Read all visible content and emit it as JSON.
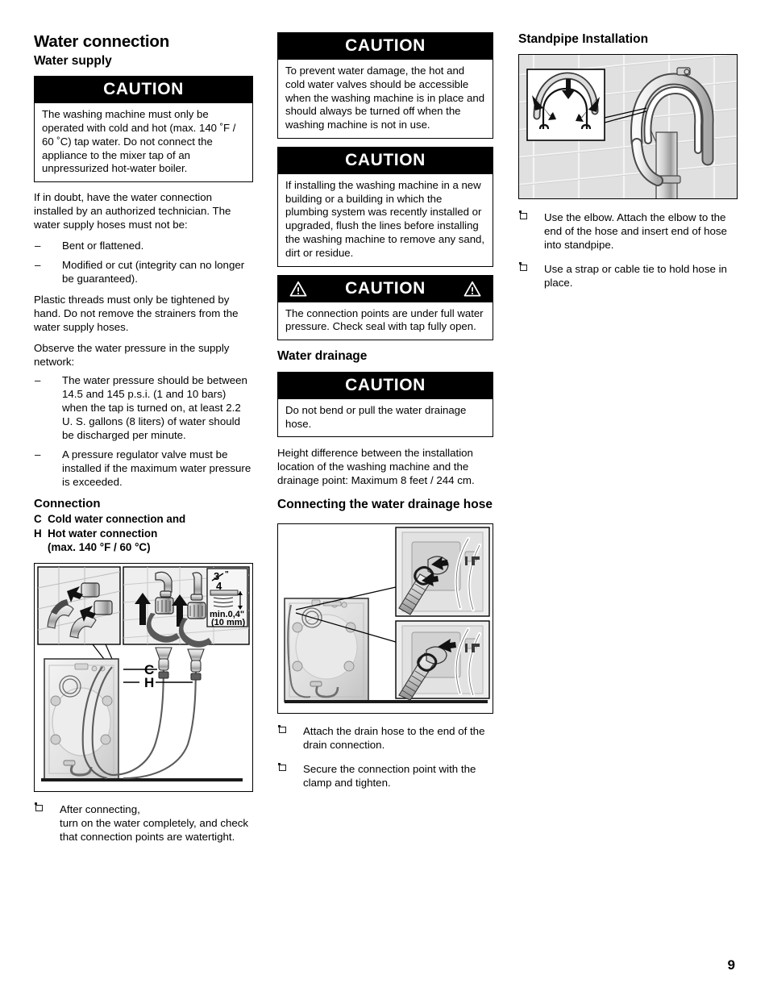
{
  "page": {
    "number": "9"
  },
  "left_column": {
    "title": "Water connection",
    "section": "Water supply",
    "caution1": {
      "label": "CAUTION",
      "text": "The washing machine must only be operated with cold and hot (max. 140 ˚F / 60 ˚C) tap water. Do not connect the appliance to the mixer tap of an unpressurized hot-water boiler."
    },
    "para1": "If in doubt, have the water connection installed by an authorized technician. The water supply hoses must not be:",
    "dash_items_1": [
      "Bent or flattened.",
      "Modified or cut (integrity can no longer be guaranteed)."
    ],
    "para2": "Plastic threads must only be tightened by hand. Do not remove the strainers from the water supply hoses.",
    "para3": "Observe the water pressure in the supply network:",
    "dash_items_2": [
      "The water pressure should be between 14.5 and 145 p.s.i. (1 and 10 bars) when the tap is turned on, at least 2.2 U. S. gallons (8 liters) of water should be discharged per minute.",
      "A pressure regulator valve must be installed if the maximum water pressure is exceeded."
    ],
    "connection_heading": "Connection",
    "connection_lines": [
      "C  Cold water connection and",
      "H  Hot water connection"
    ],
    "connection_sub": "(max. 140 °F / 60 °C)",
    "figure": {
      "name": "water-supply-hose-connection-diagram",
      "labels": {
        "cold": "C",
        "hot": "H",
        "thread_size": "3/4\"",
        "min_length": "min.0,4\"",
        "min_length_metric": "(10 mm)"
      }
    },
    "box_items": [
      "After connecting,\nturn on the water completely, and check that connection points are watertight."
    ]
  },
  "middle_column": {
    "caution1": {
      "label": "CAUTION",
      "text": "To prevent water damage, the hot and cold water valves should be accessible when the washing machine is in place and should always be turned off when the washing machine is not in use."
    },
    "caution2": {
      "label": "CAUTION",
      "text": "If installing the washing machine in a new building or a building in which the plumbing system was recently installed or upgraded, flush the lines before installing the washing machine to remove any sand, dirt or residue."
    },
    "caution3": {
      "label": "CAUTION",
      "text": "The connection points are under full water pressure. Check seal with tap fully open.",
      "has_warning_triangles": true
    },
    "drainage_heading": "Water drainage",
    "caution4": {
      "label": "CAUTION",
      "text": "Do not bend or pull the water drainage hose."
    },
    "para1": "Height difference between the installation location of the washing machine and the drainage point: Maximum 8 feet / 244 cm.",
    "connecting_heading": "Connecting the water drainage hose",
    "figure": {
      "name": "drainage-hose-attachment-diagram"
    },
    "box_items": [
      "Attach the drain hose to the end of the drain connection.",
      "Secure the connection point with the clamp and tighten."
    ]
  },
  "right_column": {
    "heading": "Standpipe Installation",
    "figure": {
      "name": "standpipe-elbow-installation-diagram"
    },
    "box_items": [
      "Use the elbow. Attach the elbow to the end of the hose and insert end of hose into standpipe.",
      "Use a strap or cable tie to hold hose in place."
    ]
  },
  "colors": {
    "caution_bar_bg": "#000000",
    "caution_bar_text": "#ffffff",
    "page_bg": "#ffffff",
    "text": "#000000"
  }
}
